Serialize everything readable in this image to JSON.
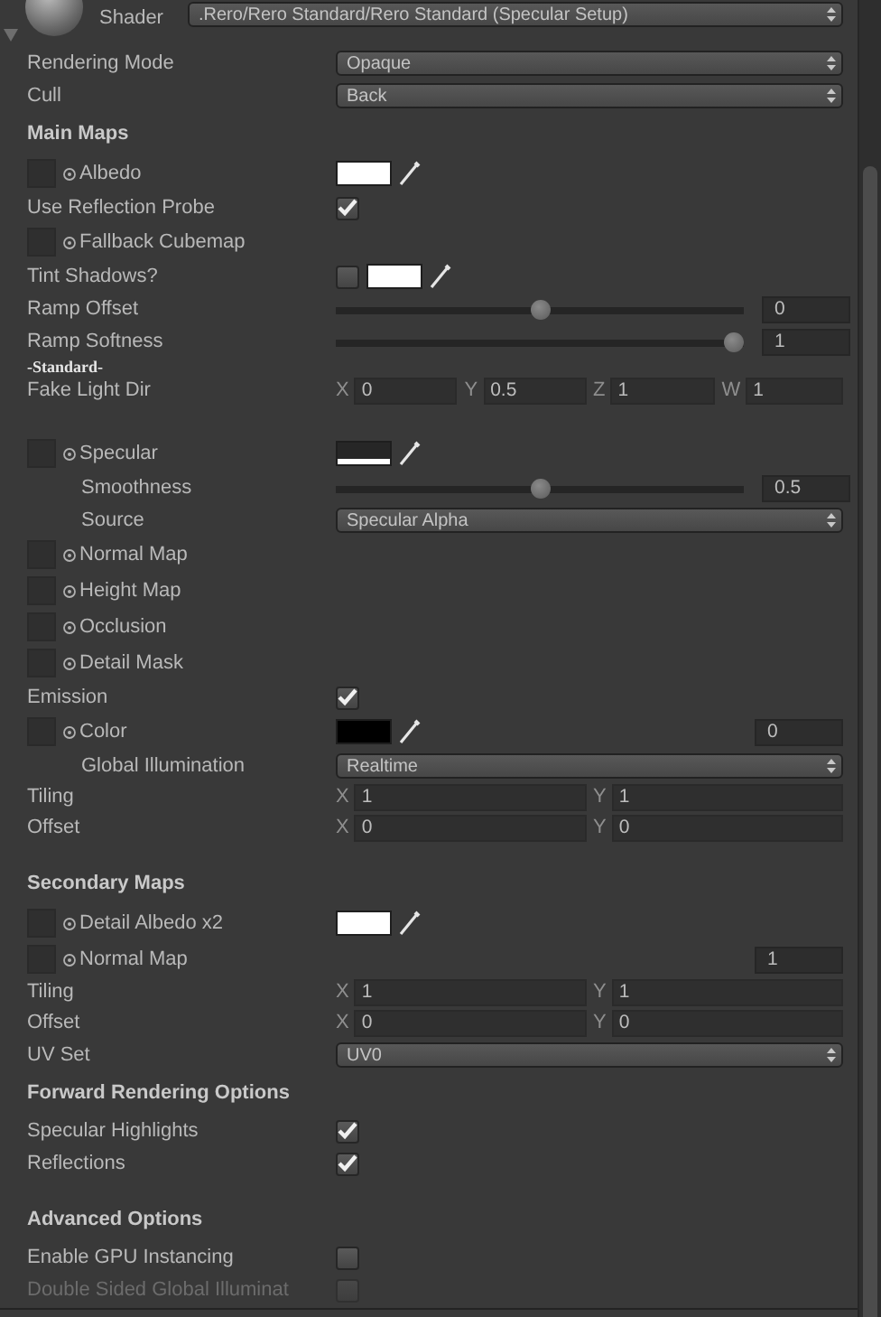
{
  "header": {
    "label": "Shader",
    "shader": ".Rero/Rero Standard/Rero Standard (Specular Setup)"
  },
  "rows": [
    {
      "kind": "dropdown",
      "label": "Rendering Mode",
      "value": "Opaque"
    },
    {
      "kind": "dropdown",
      "label": "Cull",
      "value": "Back"
    },
    {
      "kind": "header",
      "label": "Main Maps"
    },
    {
      "kind": "texture",
      "label": "Albedo",
      "color": "#ffffff"
    },
    {
      "kind": "checkbox",
      "label": "Use Reflection Probe",
      "checked": true,
      "disabled": false
    },
    {
      "kind": "texture",
      "label": "Fallback Cubemap"
    },
    {
      "kind": "toggle_color",
      "label": "Tint Shadows?",
      "checked": false,
      "color": "#ffffff"
    },
    {
      "kind": "slider",
      "label": "Ramp Offset",
      "level": 0.5,
      "reading": "0",
      "indented": false
    },
    {
      "kind": "slider",
      "label": "Ramp Softness",
      "level": 1,
      "reading": "1",
      "indented": false
    },
    {
      "kind": "note",
      "label": "-Standard-"
    },
    {
      "kind": "vector",
      "label": "Fake Light Dir",
      "components": [
        {
          "axis": "X",
          "value": "0"
        },
        {
          "axis": "Y",
          "value": "0.5"
        },
        {
          "axis": "Z",
          "value": "1"
        },
        {
          "axis": "W",
          "value": "1"
        }
      ]
    },
    {
      "kind": "texture",
      "label": "Specular",
      "color": "#262626",
      "alpha_bar": true
    },
    {
      "kind": "slider",
      "label": "Smoothness",
      "level": 0.5,
      "reading": "0.5",
      "indented": true
    },
    {
      "kind": "dropdown",
      "label": "Source",
      "value": "Specular Alpha",
      "indented": true
    },
    {
      "kind": "texture",
      "label": "Normal Map"
    },
    {
      "kind": "texture",
      "label": "Height Map"
    },
    {
      "kind": "texture",
      "label": "Occlusion"
    },
    {
      "kind": "texture",
      "label": "Detail Mask"
    },
    {
      "kind": "checkbox",
      "label": "Emission",
      "checked": true,
      "disabled": false
    },
    {
      "kind": "texture",
      "label": "Color",
      "color": "#000000",
      "reading": "0"
    },
    {
      "kind": "dropdown",
      "label": "Global Illumination",
      "value": "Realtime",
      "indented": true
    },
    {
      "kind": "vector",
      "label": "Tiling",
      "components": [
        {
          "axis": "X",
          "value": "1"
        },
        {
          "axis": "Y",
          "value": "1"
        }
      ]
    },
    {
      "kind": "vector",
      "label": "Offset",
      "components": [
        {
          "axis": "X",
          "value": "0"
        },
        {
          "axis": "Y",
          "value": "0"
        }
      ]
    },
    {
      "kind": "header",
      "label": "Secondary Maps"
    },
    {
      "kind": "texture",
      "label": "Detail Albedo x2",
      "color": "#ffffff"
    },
    {
      "kind": "texture",
      "label": "Normal Map",
      "reading": "1"
    },
    {
      "kind": "vector",
      "label": "Tiling",
      "components": [
        {
          "axis": "X",
          "value": "1"
        },
        {
          "axis": "Y",
          "value": "1"
        }
      ]
    },
    {
      "kind": "vector",
      "label": "Offset",
      "components": [
        {
          "axis": "X",
          "value": "0"
        },
        {
          "axis": "Y",
          "value": "0"
        }
      ]
    },
    {
      "kind": "dropdown",
      "label": "UV Set",
      "value": "UV0"
    },
    {
      "kind": "header",
      "label": "Forward Rendering Options"
    },
    {
      "kind": "checkbox",
      "label": "Specular Highlights",
      "checked": true,
      "disabled": false
    },
    {
      "kind": "checkbox",
      "label": "Reflections",
      "checked": true,
      "disabled": false
    },
    {
      "kind": "header",
      "label": "Advanced Options"
    },
    {
      "kind": "checkbox",
      "label": "Enable GPU Instancing",
      "checked": false,
      "disabled": false
    },
    {
      "kind": "checkbox",
      "label": "Double Sided Global Illuminat",
      "checked": false,
      "disabled": true
    }
  ]
}
